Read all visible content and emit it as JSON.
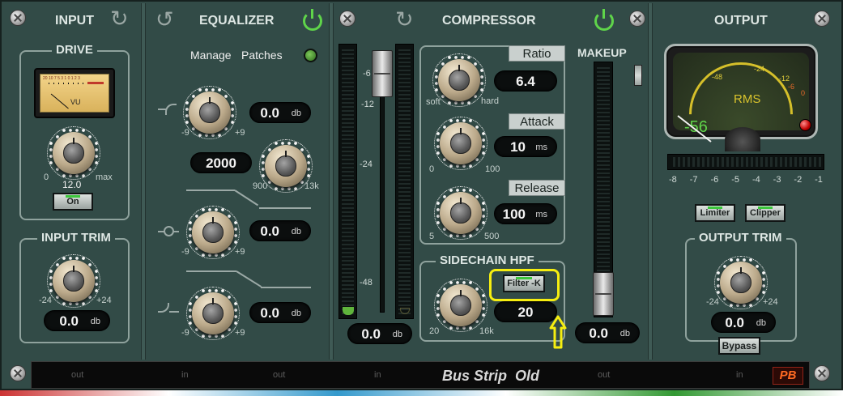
{
  "app": {
    "name": "Bus Strip Old",
    "logo": "PB"
  },
  "colors": {
    "panel": "#324b47",
    "power_on": "#5fd44a",
    "meter_needle_readout": "#5fd44a",
    "highlight": "#f6ee10",
    "led_green": "#3cc63c",
    "clip_led": "#d01010"
  },
  "input": {
    "title": "INPUT",
    "drive": {
      "label": "DRIVE",
      "vu_label": "VU",
      "vu_scale": "20 10 7 5 3 1 0 1 2 3",
      "min": "0",
      "max": "max",
      "value": "12.0",
      "on_label": "On"
    },
    "trim": {
      "label": "INPUT TRIM",
      "min": "-24",
      "max": "+24",
      "value": "0.0",
      "unit": "db"
    }
  },
  "equalizer": {
    "title": "EQUALIZER",
    "manage_label": "Manage",
    "patches_label": "Patches",
    "low_shelf": {
      "min": "-9",
      "max": "+9",
      "value": "0.0",
      "unit": "db"
    },
    "freq": {
      "value": "2000",
      "min": "900",
      "max": "13k"
    },
    "mid": {
      "min": "-9",
      "max": "+9",
      "value": "0.0",
      "unit": "db"
    },
    "high_shelf": {
      "min": "-9",
      "max": "+9",
      "value": "0.0",
      "unit": "db"
    }
  },
  "fader": {
    "scale": [
      "-6",
      "-12",
      "-24",
      "-48"
    ],
    "value": "0.0",
    "unit": "db"
  },
  "compressor": {
    "title": "COMPRESSOR",
    "ratio": {
      "label": "Ratio",
      "value": "6.4",
      "min": "soft",
      "max": "hard"
    },
    "attack": {
      "label": "Attack",
      "value": "10",
      "unit": "ms",
      "min": "0",
      "max": "100"
    },
    "release": {
      "label": "Release",
      "value": "100",
      "unit": "ms",
      "min": "5",
      "max": "500"
    },
    "sidechain": {
      "label": "SIDECHAIN HPF",
      "filter_label": "Filter -K",
      "value": "20",
      "min": "20",
      "max": "16k"
    }
  },
  "makeup": {
    "label": "MAKEUP",
    "value": "0.0",
    "unit": "db"
  },
  "output": {
    "title": "OUTPUT",
    "rms_label": "RMS",
    "rms_value": "-56",
    "meter_scale": [
      "-48",
      "-24",
      "-12",
      "-6",
      "0"
    ],
    "gr_scale": [
      "-8",
      "-7",
      "-6",
      "-5",
      "-4",
      "-3",
      "-2",
      "-1"
    ],
    "limiter_label": "Limiter",
    "clipper_label": "Clipper",
    "trim": {
      "label": "OUTPUT TRIM",
      "min": "-24",
      "max": "+24",
      "value": "0.0",
      "unit": "db"
    },
    "bypass_label": "Bypass"
  },
  "bottom_bar": {
    "slots": [
      "out",
      "in",
      "out",
      "in",
      "out",
      "in"
    ],
    "title": "Bus Strip  Old"
  },
  "annotation": {
    "arrow": "⇧"
  }
}
